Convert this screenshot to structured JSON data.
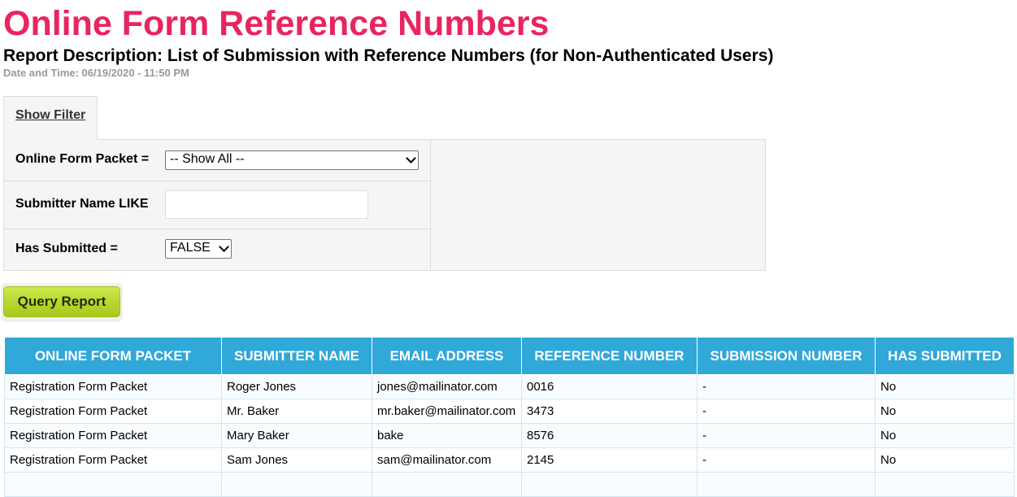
{
  "page": {
    "title": "Online Form Reference Numbers",
    "description": "Report Description: List of Submission with Reference Numbers (for Non-Authenticated Users)",
    "datetime": "Date and Time: 06/19/2020 - 11:50 PM"
  },
  "filter": {
    "toggle_label": "Show Filter",
    "packet_label": "Online Form Packet =",
    "packet_value": "-- Show All --",
    "submitter_label": "Submitter Name LIKE",
    "submitter_value": "",
    "submitted_label": "Has Submitted =",
    "submitted_value": "FALSE"
  },
  "query_button": "Query Report",
  "table": {
    "headers": [
      "ONLINE FORM PACKET",
      "SUBMITTER NAME",
      "EMAIL ADDRESS",
      "REFERENCE NUMBER",
      "SUBMISSION NUMBER",
      "HAS SUBMITTED"
    ],
    "rows": [
      [
        "Registration Form Packet",
        "Roger Jones",
        "jones@mailinator.com",
        "0016",
        "-",
        "No"
      ],
      [
        "Registration Form Packet",
        "Mr. Baker",
        "mr.baker@mailinator.com",
        "3473",
        "-",
        "No"
      ],
      [
        "Registration Form Packet",
        "Mary Baker",
        "bake",
        "8576",
        "-",
        "No"
      ],
      [
        "Registration Form Packet",
        "Sam Jones",
        "sam@mailinator.com",
        "2145",
        "-",
        "No"
      ],
      [
        "",
        "",
        "",
        "",
        "",
        ""
      ]
    ]
  }
}
